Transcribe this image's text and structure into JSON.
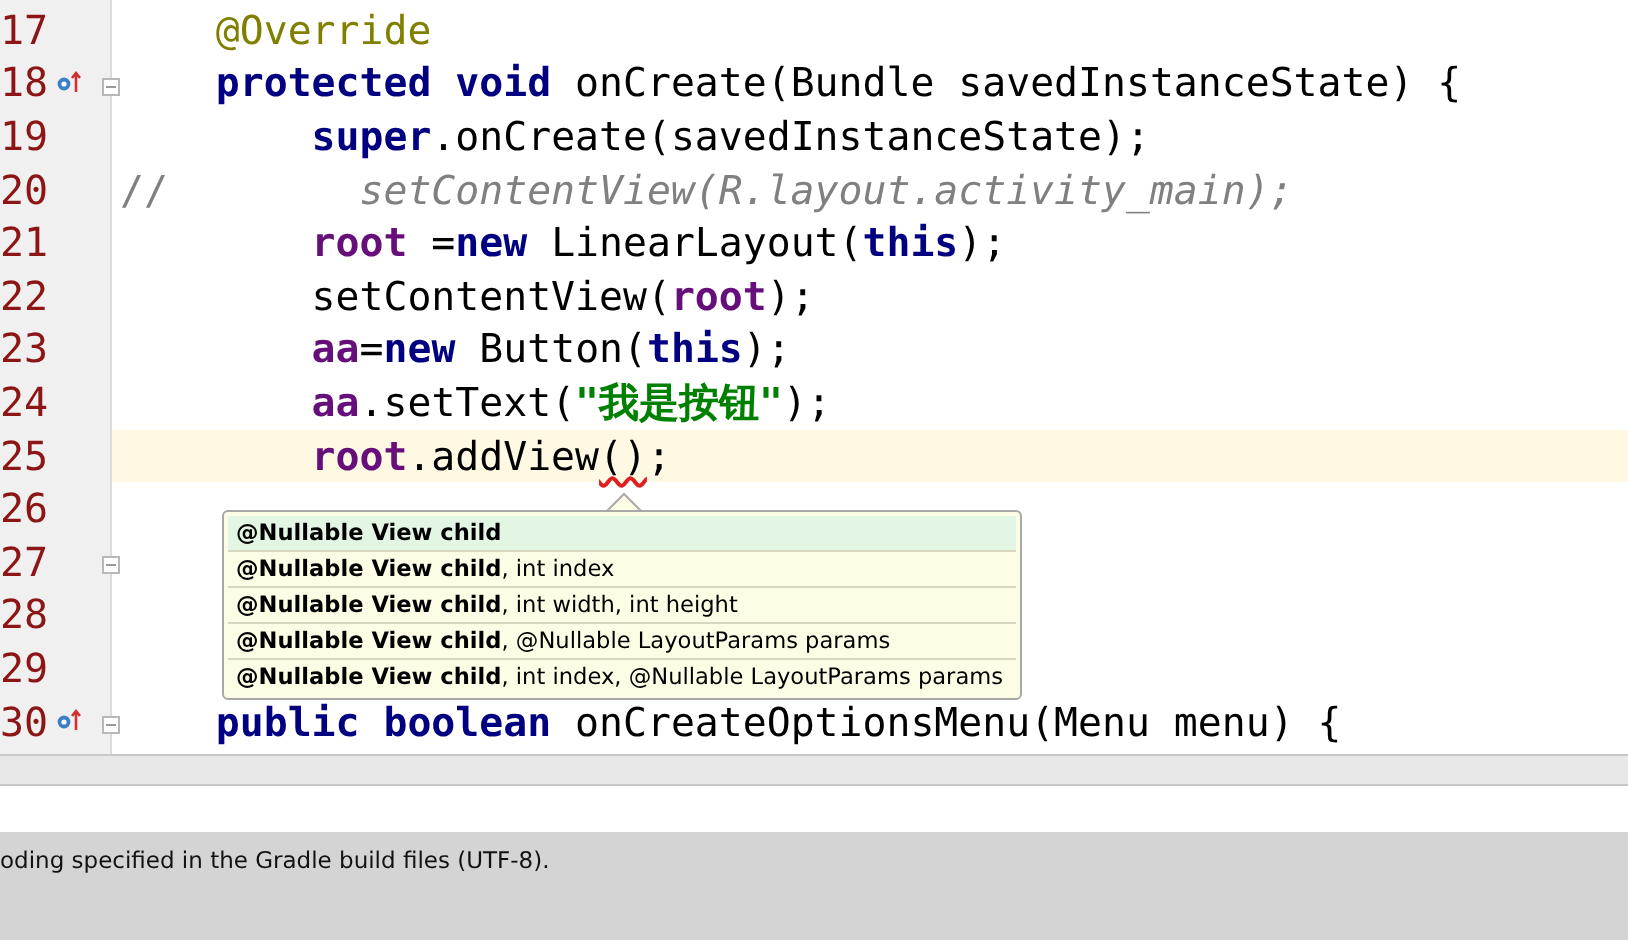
{
  "editor": {
    "lines": [
      {
        "number": "17",
        "override_mark": false,
        "fold_mark": false,
        "current": false,
        "tokens": [
          {
            "kind": "annotation",
            "text": "    @Override"
          }
        ]
      },
      {
        "number": "18",
        "override_mark": true,
        "fold_mark": true,
        "current": false,
        "tokens": [
          {
            "kind": "keyword",
            "text": "    protected void"
          },
          {
            "kind": "plain",
            "text": " onCreate(Bundle savedInstanceState) {"
          }
        ]
      },
      {
        "number": "19",
        "override_mark": false,
        "fold_mark": false,
        "current": false,
        "tokens": [
          {
            "kind": "keyword",
            "text": "        super"
          },
          {
            "kind": "plain",
            "text": ".onCreate(savedInstanceState);"
          }
        ]
      },
      {
        "number": "20",
        "override_mark": false,
        "fold_mark": false,
        "current": false,
        "tokens": [
          {
            "kind": "comment_mark",
            "text": "//"
          },
          {
            "kind": "comment",
            "text": "        setContentView(R.layout.activity_main);"
          }
        ]
      },
      {
        "number": "21",
        "override_mark": false,
        "fold_mark": false,
        "current": false,
        "tokens": [
          {
            "kind": "field",
            "text": "        root"
          },
          {
            "kind": "plain",
            "text": " ="
          },
          {
            "kind": "keyword",
            "text": "new"
          },
          {
            "kind": "plain",
            "text": " LinearLayout("
          },
          {
            "kind": "keyword",
            "text": "this"
          },
          {
            "kind": "plain",
            "text": ");"
          }
        ]
      },
      {
        "number": "22",
        "override_mark": false,
        "fold_mark": false,
        "current": false,
        "tokens": [
          {
            "kind": "plain",
            "text": "        setContentView("
          },
          {
            "kind": "field",
            "text": "root"
          },
          {
            "kind": "plain",
            "text": ");"
          }
        ]
      },
      {
        "number": "23",
        "override_mark": false,
        "fold_mark": false,
        "current": false,
        "tokens": [
          {
            "kind": "field",
            "text": "        aa"
          },
          {
            "kind": "plain",
            "text": "="
          },
          {
            "kind": "keyword",
            "text": "new"
          },
          {
            "kind": "plain",
            "text": " Button("
          },
          {
            "kind": "keyword",
            "text": "this"
          },
          {
            "kind": "plain",
            "text": ");"
          }
        ]
      },
      {
        "number": "24",
        "override_mark": false,
        "fold_mark": false,
        "current": false,
        "tokens": [
          {
            "kind": "field",
            "text": "        aa"
          },
          {
            "kind": "plain",
            "text": ".setText("
          },
          {
            "kind": "string",
            "text": "\"我是按钮\""
          },
          {
            "kind": "plain",
            "text": ");"
          }
        ]
      },
      {
        "number": "25",
        "override_mark": false,
        "fold_mark": false,
        "current": true,
        "tokens": [
          {
            "kind": "field",
            "text": "        root"
          },
          {
            "kind": "plain",
            "text": ".addView"
          },
          {
            "kind": "error",
            "text": "()"
          },
          {
            "kind": "plain",
            "text": ";"
          }
        ]
      },
      {
        "number": "26",
        "override_mark": false,
        "fold_mark": false,
        "current": false
      },
      {
        "number": "27",
        "override_mark": false,
        "fold_mark": true,
        "current": false
      },
      {
        "number": "28",
        "override_mark": false,
        "fold_mark": false,
        "current": false
      },
      {
        "number": "29",
        "override_mark": false,
        "fold_mark": false,
        "current": false
      },
      {
        "number": "30",
        "override_mark": true,
        "fold_mark": true,
        "current": false,
        "tokens": [
          {
            "kind": "keyword",
            "text": "    public boolean"
          },
          {
            "kind": "plain",
            "text": " onCreateOptionsMenu(Menu menu) {"
          }
        ]
      }
    ]
  },
  "parameter_popup": {
    "items": [
      {
        "text": "**@Nullable View child**",
        "selected": true
      },
      {
        "text": "**@Nullable View child**, int index",
        "selected": false
      },
      {
        "text": "**@Nullable View child**, int width, int height",
        "selected": false
      },
      {
        "text": "**@Nullable View child**, @Nullable LayoutParams params",
        "selected": false
      },
      {
        "text": "**@Nullable View child**, int index, @Nullable LayoutParams params",
        "selected": false
      }
    ]
  },
  "message_panel": {
    "text": "oding specified in the Gradle build files (UTF-8)."
  }
}
